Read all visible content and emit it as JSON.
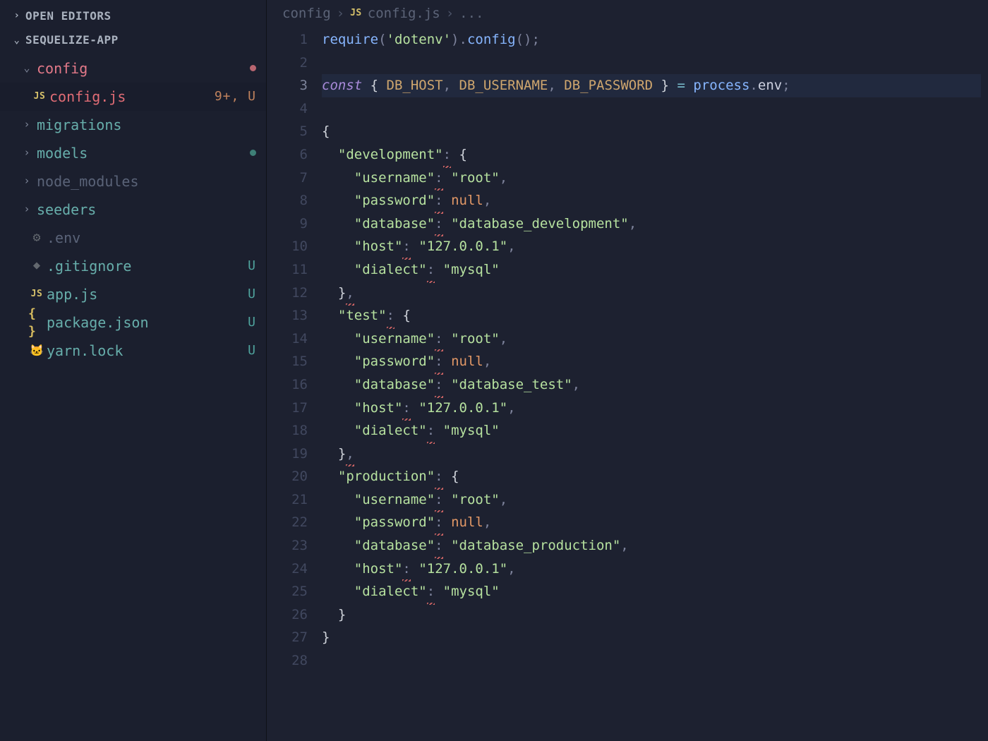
{
  "sidebar": {
    "open_editors_label": "OPEN EDITORS",
    "project_label": "SEQUELIZE-APP",
    "items": [
      {
        "label": "config",
        "kind": "folder-open",
        "depth": 1,
        "color": "rose",
        "dot": "#b86570",
        "status": "",
        "icon": "chevron-down"
      },
      {
        "label": "config.js",
        "kind": "file",
        "depth": 2,
        "color": "rose",
        "status": "9+, U",
        "icon": "js",
        "active": true
      },
      {
        "label": "migrations",
        "kind": "folder",
        "depth": 1,
        "color": "teal",
        "status": "",
        "icon": "chevron-right"
      },
      {
        "label": "models",
        "kind": "folder",
        "depth": 1,
        "color": "teal",
        "dot": "#3e8077",
        "status": "",
        "icon": "chevron-right"
      },
      {
        "label": "node_modules",
        "kind": "folder",
        "depth": 1,
        "color": "muted",
        "status": "",
        "icon": "chevron-right"
      },
      {
        "label": "seeders",
        "kind": "folder",
        "depth": 1,
        "color": "teal",
        "status": "",
        "icon": "chevron-right"
      },
      {
        "label": ".env",
        "kind": "file",
        "depth": 0,
        "color": "muted",
        "status": "",
        "icon": "gear"
      },
      {
        "label": ".gitignore",
        "kind": "file",
        "depth": 0,
        "color": "teal",
        "status": "U",
        "icon": "git"
      },
      {
        "label": "app.js",
        "kind": "file",
        "depth": 0,
        "color": "teal",
        "status": "U",
        "icon": "js"
      },
      {
        "label": "package.json",
        "kind": "file",
        "depth": 0,
        "color": "teal",
        "status": "U",
        "icon": "json"
      },
      {
        "label": "yarn.lock",
        "kind": "file",
        "depth": 0,
        "color": "teal",
        "status": "U",
        "icon": "yarn"
      }
    ]
  },
  "breadcrumb": {
    "part1": "config",
    "part2": "config.js",
    "part3": "..."
  },
  "editor": {
    "lines": [
      {
        "n": 1,
        "tokens": [
          [
            "fn",
            "require"
          ],
          [
            "punc",
            "("
          ],
          [
            "str",
            "'dotenv'"
          ],
          [
            "punc",
            ")."
          ],
          [
            "fn",
            "config"
          ],
          [
            "punc",
            "();"
          ]
        ]
      },
      {
        "n": 2,
        "tokens": []
      },
      {
        "n": 3,
        "hl": true,
        "tokens": [
          [
            "kw",
            "const"
          ],
          [
            "text",
            " "
          ],
          [
            "punc-br",
            "{ "
          ],
          [
            "const",
            "DB_HOST"
          ],
          [
            "punc",
            ", "
          ],
          [
            "const",
            "DB_USERNAME"
          ],
          [
            "punc",
            ", "
          ],
          [
            "const",
            "DB_PASSWORD"
          ],
          [
            "punc-br",
            " }"
          ],
          [
            "text",
            " "
          ],
          [
            "op",
            "="
          ],
          [
            "text",
            " "
          ],
          [
            "obj",
            "process"
          ],
          [
            "punc",
            "."
          ],
          [
            "prop",
            "env"
          ],
          [
            "punc",
            ";"
          ]
        ]
      },
      {
        "n": 4,
        "tokens": []
      },
      {
        "n": 5,
        "tokens": [
          [
            "punc-br",
            "{"
          ]
        ]
      },
      {
        "n": 6,
        "tokens": [
          [
            "text",
            "  "
          ],
          [
            "keystr",
            "\"development\""
          ],
          [
            "err",
            ":"
          ],
          [
            "text",
            " "
          ],
          [
            "punc-br",
            "{"
          ]
        ]
      },
      {
        "n": 7,
        "tokens": [
          [
            "text",
            "    "
          ],
          [
            "keystr",
            "\"username\""
          ],
          [
            "err",
            ":"
          ],
          [
            "text",
            " "
          ],
          [
            "str",
            "\"root\""
          ],
          [
            "punc",
            ","
          ]
        ]
      },
      {
        "n": 8,
        "tokens": [
          [
            "text",
            "    "
          ],
          [
            "keystr",
            "\"password\""
          ],
          [
            "err",
            ":"
          ],
          [
            "text",
            " "
          ],
          [
            "null",
            "null"
          ],
          [
            "punc",
            ","
          ]
        ]
      },
      {
        "n": 9,
        "tokens": [
          [
            "text",
            "    "
          ],
          [
            "keystr",
            "\"database\""
          ],
          [
            "err",
            ":"
          ],
          [
            "text",
            " "
          ],
          [
            "str",
            "\"database_development\""
          ],
          [
            "punc",
            ","
          ]
        ]
      },
      {
        "n": 10,
        "tokens": [
          [
            "text",
            "    "
          ],
          [
            "keystr",
            "\"host\""
          ],
          [
            "err",
            ":"
          ],
          [
            "text",
            " "
          ],
          [
            "str",
            "\"127.0.0.1\""
          ],
          [
            "punc",
            ","
          ]
        ]
      },
      {
        "n": 11,
        "tokens": [
          [
            "text",
            "    "
          ],
          [
            "keystr",
            "\"dialect\""
          ],
          [
            "err",
            ":"
          ],
          [
            "text",
            " "
          ],
          [
            "str",
            "\"mysql\""
          ]
        ]
      },
      {
        "n": 12,
        "tokens": [
          [
            "text",
            "  "
          ],
          [
            "punc-br",
            "}"
          ],
          [
            "err",
            ","
          ]
        ]
      },
      {
        "n": 13,
        "tokens": [
          [
            "text",
            "  "
          ],
          [
            "keystr",
            "\"test\""
          ],
          [
            "err",
            ":"
          ],
          [
            "text",
            " "
          ],
          [
            "punc-br",
            "{"
          ]
        ]
      },
      {
        "n": 14,
        "tokens": [
          [
            "text",
            "    "
          ],
          [
            "keystr",
            "\"username\""
          ],
          [
            "err",
            ":"
          ],
          [
            "text",
            " "
          ],
          [
            "str",
            "\"root\""
          ],
          [
            "punc",
            ","
          ]
        ]
      },
      {
        "n": 15,
        "tokens": [
          [
            "text",
            "    "
          ],
          [
            "keystr",
            "\"password\""
          ],
          [
            "err",
            ":"
          ],
          [
            "text",
            " "
          ],
          [
            "null",
            "null"
          ],
          [
            "punc",
            ","
          ]
        ]
      },
      {
        "n": 16,
        "tokens": [
          [
            "text",
            "    "
          ],
          [
            "keystr",
            "\"database\""
          ],
          [
            "err",
            ":"
          ],
          [
            "text",
            " "
          ],
          [
            "str",
            "\"database_test\""
          ],
          [
            "punc",
            ","
          ]
        ]
      },
      {
        "n": 17,
        "tokens": [
          [
            "text",
            "    "
          ],
          [
            "keystr",
            "\"host\""
          ],
          [
            "err",
            ":"
          ],
          [
            "text",
            " "
          ],
          [
            "str",
            "\"127.0.0.1\""
          ],
          [
            "punc",
            ","
          ]
        ]
      },
      {
        "n": 18,
        "tokens": [
          [
            "text",
            "    "
          ],
          [
            "keystr",
            "\"dialect\""
          ],
          [
            "err",
            ":"
          ],
          [
            "text",
            " "
          ],
          [
            "str",
            "\"mysql\""
          ]
        ]
      },
      {
        "n": 19,
        "tokens": [
          [
            "text",
            "  "
          ],
          [
            "punc-br",
            "}"
          ],
          [
            "err",
            ","
          ]
        ]
      },
      {
        "n": 20,
        "tokens": [
          [
            "text",
            "  "
          ],
          [
            "keystr",
            "\"production\""
          ],
          [
            "err",
            ":"
          ],
          [
            "text",
            " "
          ],
          [
            "punc-br",
            "{"
          ]
        ]
      },
      {
        "n": 21,
        "tokens": [
          [
            "text",
            "    "
          ],
          [
            "keystr",
            "\"username\""
          ],
          [
            "err",
            ":"
          ],
          [
            "text",
            " "
          ],
          [
            "str",
            "\"root\""
          ],
          [
            "punc",
            ","
          ]
        ]
      },
      {
        "n": 22,
        "tokens": [
          [
            "text",
            "    "
          ],
          [
            "keystr",
            "\"password\""
          ],
          [
            "err",
            ":"
          ],
          [
            "text",
            " "
          ],
          [
            "null",
            "null"
          ],
          [
            "punc",
            ","
          ]
        ]
      },
      {
        "n": 23,
        "tokens": [
          [
            "text",
            "    "
          ],
          [
            "keystr",
            "\"database\""
          ],
          [
            "err",
            ":"
          ],
          [
            "text",
            " "
          ],
          [
            "str",
            "\"database_production\""
          ],
          [
            "punc",
            ","
          ]
        ]
      },
      {
        "n": 24,
        "tokens": [
          [
            "text",
            "    "
          ],
          [
            "keystr",
            "\"host\""
          ],
          [
            "err",
            ":"
          ],
          [
            "text",
            " "
          ],
          [
            "str",
            "\"127.0.0.1\""
          ],
          [
            "punc",
            ","
          ]
        ]
      },
      {
        "n": 25,
        "tokens": [
          [
            "text",
            "    "
          ],
          [
            "keystr",
            "\"dialect\""
          ],
          [
            "err",
            ":"
          ],
          [
            "text",
            " "
          ],
          [
            "str",
            "\"mysql\""
          ]
        ]
      },
      {
        "n": 26,
        "tokens": [
          [
            "text",
            "  "
          ],
          [
            "punc-br",
            "}"
          ]
        ]
      },
      {
        "n": 27,
        "tokens": [
          [
            "punc-br",
            "}"
          ]
        ]
      },
      {
        "n": 28,
        "tokens": []
      }
    ],
    "current_line": 3
  }
}
